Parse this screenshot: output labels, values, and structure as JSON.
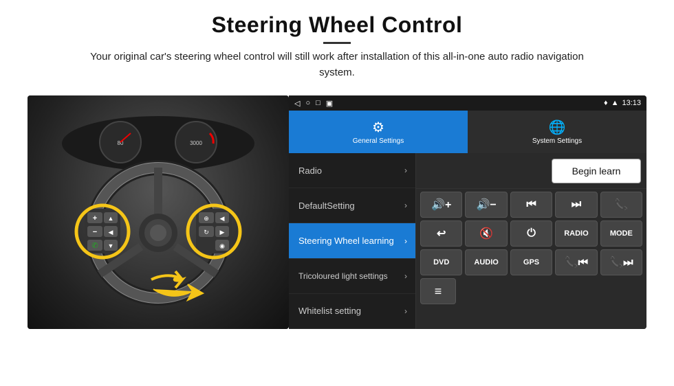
{
  "header": {
    "title": "Steering Wheel Control",
    "subtitle": "Your original car's steering wheel control will still work after installation of this all-in-one auto radio navigation system."
  },
  "status_bar": {
    "nav_icons": [
      "◁",
      "○",
      "□",
      "▣"
    ],
    "right_icons": "♦ ▲",
    "time": "13:13"
  },
  "tabs": [
    {
      "id": "general",
      "label": "General Settings",
      "icon": "⚙",
      "active": true
    },
    {
      "id": "system",
      "label": "System Settings",
      "icon": "🌐",
      "active": false
    }
  ],
  "menu": {
    "items": [
      {
        "id": "radio",
        "label": "Radio",
        "active": false
      },
      {
        "id": "default",
        "label": "DefaultSetting",
        "active": false
      },
      {
        "id": "steering",
        "label": "Steering Wheel learning",
        "active": true
      },
      {
        "id": "tricoloured",
        "label": "Tricoloured light settings",
        "active": false
      },
      {
        "id": "whitelist",
        "label": "Whitelist setting",
        "active": false
      }
    ]
  },
  "controls": {
    "begin_learn_label": "Begin learn",
    "button_rows": [
      [
        "🔊+",
        "🔊−",
        "⏮",
        "⏭",
        "📞"
      ],
      [
        "↩",
        "🔊✕",
        "⏻",
        "RADIO",
        "MODE"
      ],
      [
        "DVD",
        "AUDIO",
        "GPS",
        "📞⏮",
        "📞⏭"
      ]
    ],
    "whitelist_icon": "≡"
  }
}
